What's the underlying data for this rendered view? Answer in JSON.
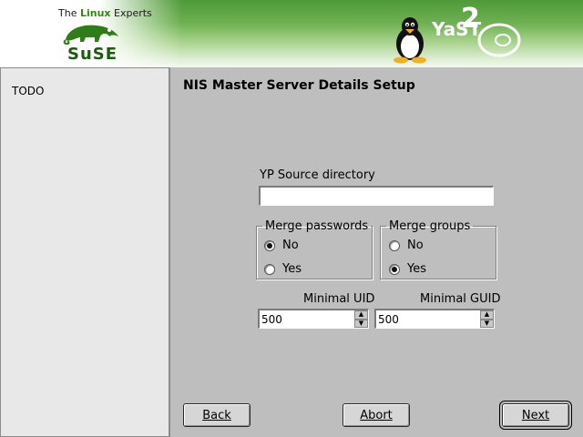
{
  "header": {
    "tagline_pre": "The ",
    "tagline_brand": "Linux",
    "tagline_post": " Experts",
    "suse_logo_text": "SuSE",
    "yast_logo_text": "YaST",
    "yast_version": "2",
    "icons": [
      "chameleon-icon",
      "tux-penguin-icon",
      "yast-logo-icon"
    ]
  },
  "help": {
    "text": "TODO"
  },
  "page": {
    "title": "NIS Master Server Details Setup"
  },
  "form": {
    "source_dir": {
      "label": "YP Source directory",
      "value": ""
    },
    "merge_passwords": {
      "title": "Merge passwords",
      "options": [
        {
          "label": "No",
          "checked": true
        },
        {
          "label": "Yes",
          "checked": false
        }
      ]
    },
    "merge_groups": {
      "title": "Merge groups",
      "options": [
        {
          "label": "No",
          "checked": false
        },
        {
          "label": "Yes",
          "checked": true
        }
      ]
    },
    "min_uid": {
      "label": "Minimal UID",
      "value": "500"
    },
    "min_gid": {
      "label": "Minimal GUID",
      "value": "500"
    }
  },
  "buttons": {
    "back": "Back",
    "abort": "Abort",
    "next": "Next"
  },
  "colors": {
    "header_green": "#4f9a38",
    "window_bg": "#bebebe",
    "help_bg": "#e8e8e8"
  }
}
